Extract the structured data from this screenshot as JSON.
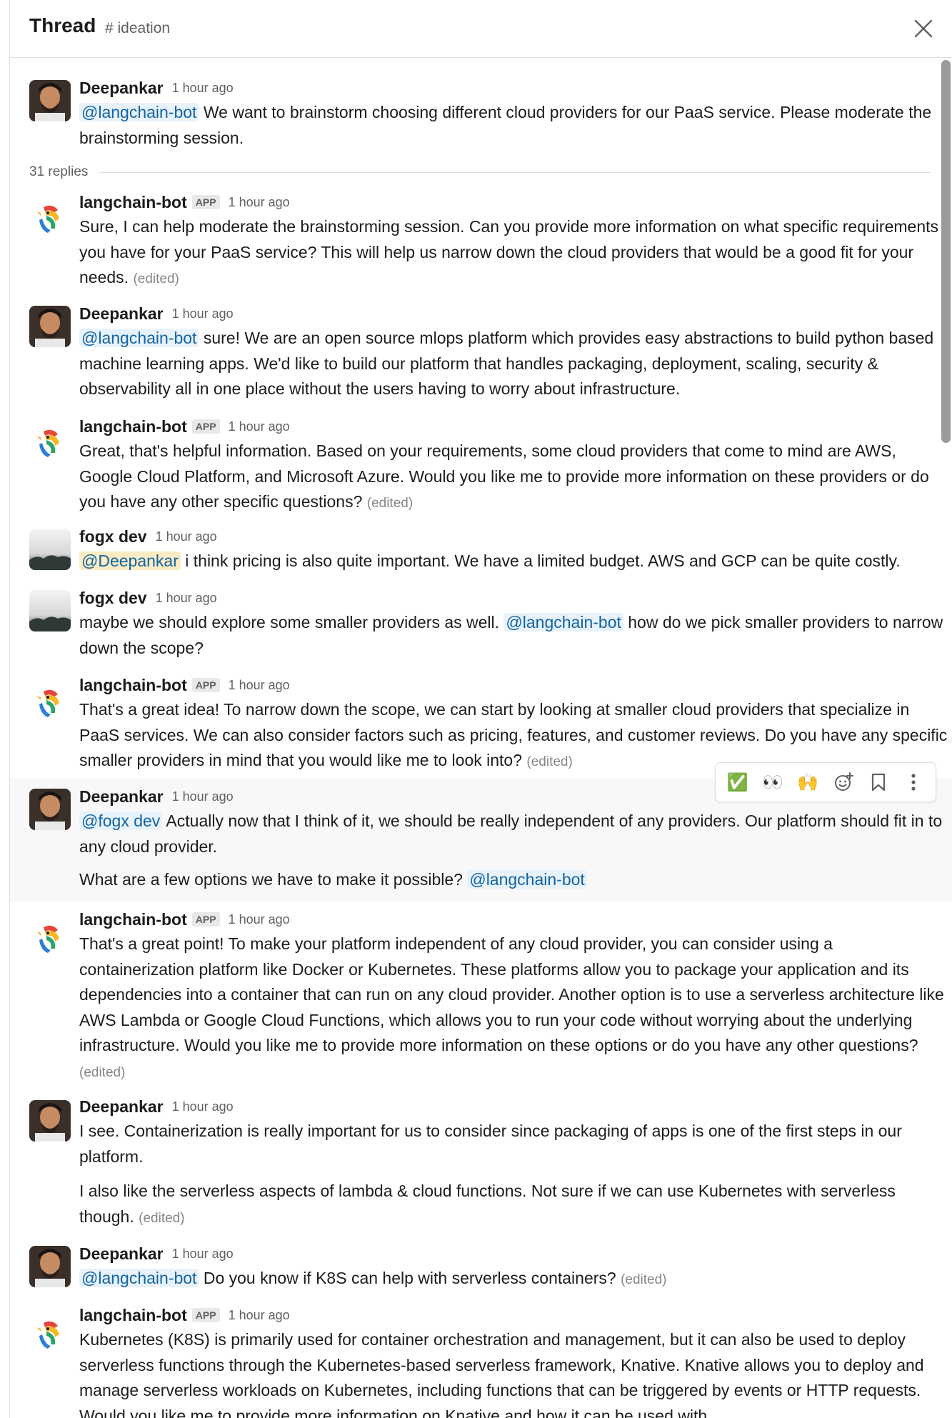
{
  "header": {
    "title": "Thread",
    "channel": "# ideation"
  },
  "parent": {
    "author": "Deepankar",
    "time": "1 hour ago",
    "mention": "@langchain-bot",
    "text": " We want to brainstorm choosing different cloud providers for our PaaS service. Please moderate the brainstorming session."
  },
  "replies_count": "31 replies",
  "messages": [
    {
      "author": "langchain-bot",
      "badge": "APP",
      "time": "1 hour ago",
      "text": "Sure, I can help moderate the brainstorming session. Can you provide more information on what specific requirements you have for your PaaS service? This will help us narrow down the cloud providers that would be a good fit for your needs. ",
      "edited": "(edited)"
    },
    {
      "author": "Deepankar",
      "time": "1 hour ago",
      "mention": "@langchain-bot",
      "text": " sure! We are an open source mlops platform which provides easy abstractions to build python based machine learning apps. We'd like to build our platform that handles packaging, deployment, scaling, security & observability all in one place without the users having to worry about infrastructure."
    },
    {
      "author": "langchain-bot",
      "badge": "APP",
      "time": "1 hour ago",
      "text": "Great, that's helpful information. Based on your requirements, some cloud providers that come to mind are AWS, Google Cloud Platform, and Microsoft Azure. Would you like me to provide more information on these providers or do you have any other specific questions? ",
      "edited": "(edited)"
    },
    {
      "author": "fogx dev",
      "time": "1 hour ago",
      "mention": "@Deepankar",
      "text": " i think pricing is also quite important. We have a limited budget. AWS and GCP can be quite costly."
    },
    {
      "author": "fogx dev",
      "time": "1 hour ago",
      "text_before": "maybe we should explore some smaller providers as well. ",
      "mention": "@langchain-bot",
      "text": " how do we pick smaller providers to narrow down the scope?"
    },
    {
      "author": "langchain-bot",
      "badge": "APP",
      "time": "1 hour ago",
      "text": "That's a great idea! To narrow down the scope, we can start by looking at smaller cloud providers that specialize in PaaS services. We can also consider factors such as pricing, features, and customer reviews. Do you have any specific smaller providers in mind that you would like me to look into? ",
      "edited": "(edited)"
    },
    {
      "author": "Deepankar",
      "time": "1 hour ago",
      "mention": "@fogx dev",
      "text": " Actually now that I think of it, we should be really independent of any providers. Our platform should fit in to any cloud provider.",
      "text2": "What are a few options we have to make it possible? ",
      "mention2": "@langchain-bot"
    },
    {
      "author": "langchain-bot",
      "badge": "APP",
      "time": "1 hour ago",
      "text": "That's a great point! To make your platform independent of any cloud provider, you can consider using a containerization platform like Docker or Kubernetes. These platforms allow you to package your application and its dependencies into a container that can run on any cloud provider. Another option is to use a serverless architecture like AWS Lambda or Google Cloud Functions, which allows you to run your code without worrying about the underlying infrastructure. Would you like me to provide more information on these options or do you have any other questions? ",
      "edited": "(edited)"
    },
    {
      "author": "Deepankar",
      "time": "1 hour ago",
      "text": "I see. Containerization is really important for us to consider since packaging of apps is one of the first steps in our platform.",
      "text2": "I also like the serverless aspects of lambda & cloud functions. Not sure if we can use Kubernetes with serverless though. ",
      "edited": "(edited)"
    },
    {
      "author": "Deepankar",
      "time": "1 hour ago",
      "mention": "@langchain-bot",
      "text": " Do you know if K8S can help with serverless containers? ",
      "edited": "(edited)"
    },
    {
      "author": "langchain-bot",
      "badge": "APP",
      "time": "1 hour ago",
      "text": "Kubernetes (K8S) is primarily used for container orchestration and management, but it can also be used to deploy serverless functions through the Kubernetes-based serverless framework, Knative. Knative allows you to deploy and manage serverless workloads on Kubernetes, including functions that can be triggered by events or HTTP requests. Would you like me to provide more information on Knative and how it can be used with"
    }
  ],
  "toolbar": {
    "check": "✅",
    "eyes": "👀",
    "hands": "🙌"
  }
}
